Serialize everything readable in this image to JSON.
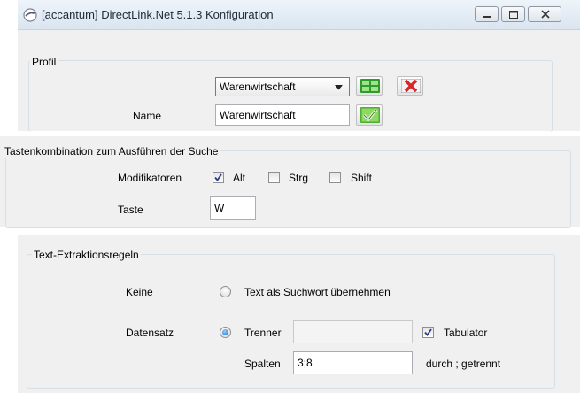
{
  "window": {
    "title": "[accantum] DirectLink.Net 5.1.3 Konfiguration"
  },
  "profil": {
    "legend": "Profil",
    "select_value": "Warenwirtschaft",
    "name_label": "Name",
    "name_value": "Warenwirtschaft"
  },
  "tasten": {
    "legend": "Tastenkombination zum Ausführen der Suche",
    "modifiers_label": "Modifikatoren",
    "alt_label": "Alt",
    "alt_checked": true,
    "strg_label": "Strg",
    "strg_checked": false,
    "shift_label": "Shift",
    "shift_checked": false,
    "taste_label": "Taste",
    "taste_value": "W"
  },
  "extraktion": {
    "legend": "Text-Extraktionsregeln",
    "keine_label": "Keine",
    "keine_option": "Text als Suchwort übernehmen",
    "keine_selected": false,
    "datensatz_label": "Datensatz",
    "trenner_label": "Trenner",
    "trenner_value": "",
    "datensatz_selected": true,
    "tabulator_label": "Tabulator",
    "tabulator_checked": true,
    "spalten_label": "Spalten",
    "spalten_value": "3;8",
    "spalten_hint": "durch ; getrennt"
  },
  "colors": {
    "accent_green": "#4caf3c",
    "accent_red": "#d62828",
    "border": "#d5dfe5"
  }
}
